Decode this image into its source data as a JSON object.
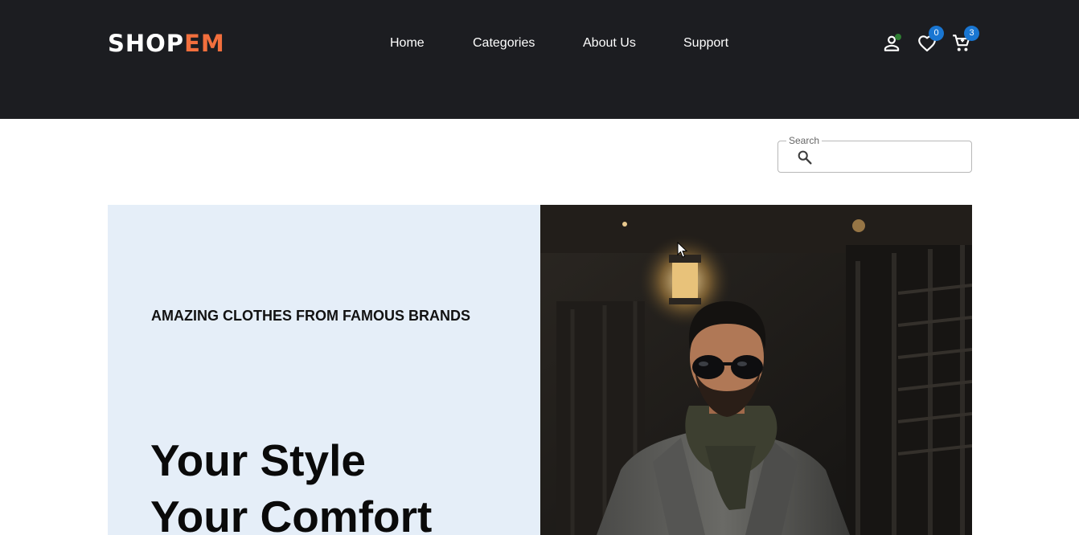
{
  "brand": {
    "part1": "SHOP",
    "part2": "EM",
    "color_primary": "#ffffff",
    "color_accent": "#f26f3d"
  },
  "nav": {
    "items": [
      "Home",
      "Categories",
      "About Us",
      "Support"
    ]
  },
  "header_icons": {
    "account": {
      "icon": "person-icon",
      "status": "online"
    },
    "wishlist": {
      "icon": "heart-icon",
      "count": "0"
    },
    "cart": {
      "icon": "cart-icon",
      "count": "3"
    }
  },
  "search": {
    "label": "Search",
    "value": "",
    "placeholder": ""
  },
  "hero": {
    "tagline": "AMAZING CLOTHES FROM FAMOUS BRANDS",
    "title_line1": "Your Style",
    "title_line2": "Your Comfort",
    "image": "man-in-sunglasses-and-scarf-photo"
  },
  "colors": {
    "header_bg": "#1c1d21",
    "hero_bg": "#e5eef8",
    "badge": "#1976d2"
  }
}
